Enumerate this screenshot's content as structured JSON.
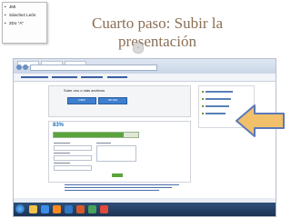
{
  "note": {
    "items": [
      "JMI",
      "Sánchez León",
      "2Do \"A\""
    ]
  },
  "slide": {
    "title_line1": "Cuarto paso: Subir la",
    "title_line2": "presentación"
  },
  "colors": {
    "title": "#8a6f55",
    "arrow_fill": "#f1c06a",
    "arrow_stroke": "#5b79b8",
    "upload_button": "#3f7fcf",
    "taskbar": "#1c3354"
  },
  "screenshot": {
    "upload_heading": "Sube uno o más archivos",
    "upload_button_1": "SUBIR",
    "upload_button_2": "UPLOAD",
    "progress_percent": "83%",
    "progress_value": 0.83
  },
  "icons": {
    "arrow": "left-arrow-icon",
    "start": "windows-start-icon",
    "nav": "slide-nav-icon"
  }
}
